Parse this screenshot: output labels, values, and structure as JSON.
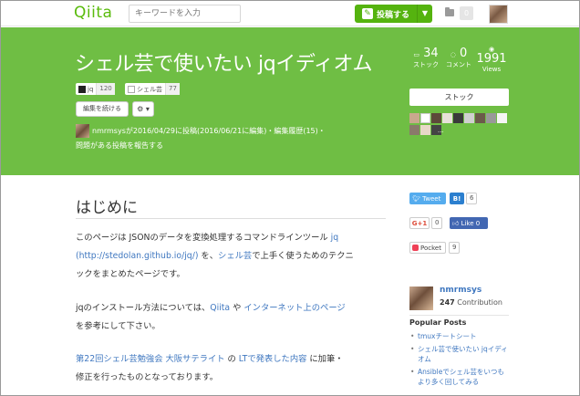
{
  "header": {
    "logo": "Qiita",
    "search_placeholder": "キーワードを入力",
    "post_button": "投稿する",
    "post_icon": "pencil-icon",
    "caret": "▼",
    "notification_count": "0"
  },
  "article": {
    "title": "シェル芸で使いたい jqイディオム",
    "tags": [
      {
        "name": "jq",
        "count": "120"
      },
      {
        "name": "シェル芸",
        "count": "77"
      }
    ],
    "edit_button": "編集を続ける",
    "gear_button": "⚙ ▾",
    "meta_line1": "nmrmsysが2016/04/29に投稿(2016/06/21に編集)・編集履歴(15)・",
    "meta_line2": "問題がある投稿を報告する",
    "stats": {
      "stock_count": "34",
      "stock_label": "ストック",
      "comment_count": "0",
      "comment_label": "コメント",
      "views_count": "1991",
      "views_label": "Views"
    },
    "stock_button": "ストック",
    "stockers_more": "...",
    "heading": "はじめに",
    "paragraph1_line1_a": "このページは JSONのデータを変換処理するコマンドラインツール ",
    "paragraph1_link_jq": "jq",
    "paragraph1_line2_link": "(http://stedolan.github.io/jq/)",
    "paragraph1_line2_b": " を、",
    "paragraph1_link_shell": "シェル芸",
    "paragraph1_line2_c": "で上手く使うためのテクニ",
    "paragraph1_line3": "ックをまとめたページです。",
    "paragraph2_a": "jqのインストール方法については、",
    "paragraph2_link1": "Qiita",
    "paragraph2_b": " や ",
    "paragraph2_link2": "インターネット上のページ",
    "paragraph2_line2": "を参考にして下さい。",
    "paragraph3_link1": "第22回シェル芸勉強会 大阪サテライト",
    "paragraph3_a": " の ",
    "paragraph3_link2": "LTで発表した内容",
    "paragraph3_b": " に加筆・",
    "paragraph3_line2": "修正を行ったものとなっております。"
  },
  "sidebar": {
    "tweet_label": "Tweet",
    "hatena_label": "B!",
    "hatena_count": "6",
    "gplus_label": "G+1",
    "gplus_count": "0",
    "fb_label": "Like 0",
    "pocket_label": "Pocket",
    "pocket_count": "9",
    "author_name": "nmrmsys",
    "contribution_count": "247",
    "contribution_label": " Contribution",
    "popular_title": "Popular Posts",
    "popular_posts": [
      "tmuxチートシート",
      "シェル芸で使いたい jqイディオム",
      "Ansibleでシェル芸をいつもより多く回してみる"
    ]
  },
  "colors": {
    "brand_green": "#55b30f",
    "hero_green": "#6fbe44",
    "link_blue": "#4078c0"
  }
}
